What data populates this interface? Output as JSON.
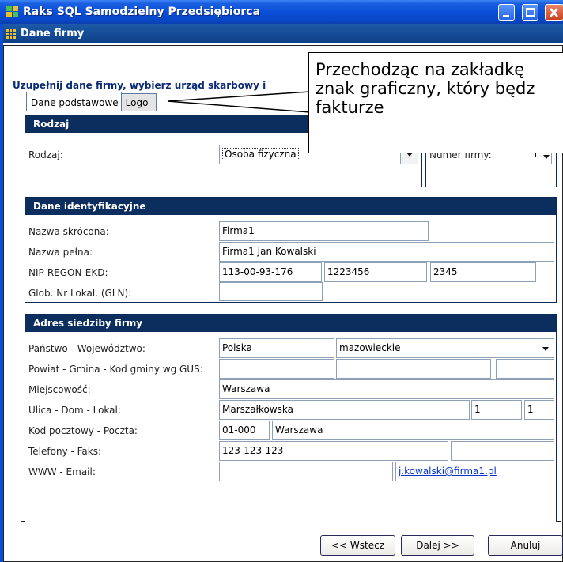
{
  "window": {
    "title": "Raks SQL Samodzielny Przedsiębiorca"
  },
  "subwindow": {
    "title": "Dane firmy"
  },
  "instruction": "Uzupełnij dane firmy, wybierz urząd skarbowy i",
  "tabs": [
    "Dane podstawowe",
    "Logo"
  ],
  "callout": {
    "lines": [
      "Przechodząc na zakładkę",
      "znak graficzny, który będz",
      "fakturze"
    ]
  },
  "rodzaj": {
    "header": "Rodzaj",
    "label": "Rodzaj:",
    "value": "Osoba fizyczna",
    "numer_label": "Numer firmy:",
    "numer_value": "1"
  },
  "identyfikacyjne": {
    "header": "Dane identyfikacyjne",
    "nazwa_skrocona_label": "Nazwa skrócona:",
    "nazwa_skrocona": "Firma1",
    "nazwa_pelna_label": "Nazwa pełna:",
    "nazwa_pelna": "Firma1 Jan Kowalski",
    "nip_label": "NIP-REGON-EKD:",
    "nip": "113-00-93-176",
    "regon": "1223456",
    "ekd": "2345",
    "gln_label": "Glob. Nr Lokal. (GLN):",
    "gln": ""
  },
  "adres": {
    "header": "Adres siedziby firmy",
    "panstwo_label": "Państwo - Województwo:",
    "panstwo": "Polska",
    "wojewodztwo": "mazowieckie",
    "powiat_label": "Powiat - Gmina - Kod gminy wg GUS:",
    "powiat": "",
    "gmina": "",
    "kod_gminy": "",
    "miejscowosc_label": "Miejscowość:",
    "miejscowosc": "Warszawa",
    "ulica_label": "Ulica - Dom - Lokal:",
    "ulica": "Marszałkowska",
    "dom": "1",
    "lokal": "1",
    "kod_label": "Kod pocztowy - Poczta:",
    "kod": "01-000",
    "poczta": "Warszawa",
    "telefony_label": "Telefony - Faks:",
    "telefony": "123-123-123",
    "faks": "",
    "www_label": "WWW - Email:",
    "www": "",
    "email": "j.kowalski@firma1.pl"
  },
  "buttons": {
    "back": "<< Wstecz",
    "next": "Dalej >>",
    "cancel": "Anuluj"
  },
  "colors": {
    "titlebar": "#0a4fd8",
    "section_header": "#0c2e5e",
    "instruction_text": "#0a2a78",
    "link": "#0033cc"
  }
}
